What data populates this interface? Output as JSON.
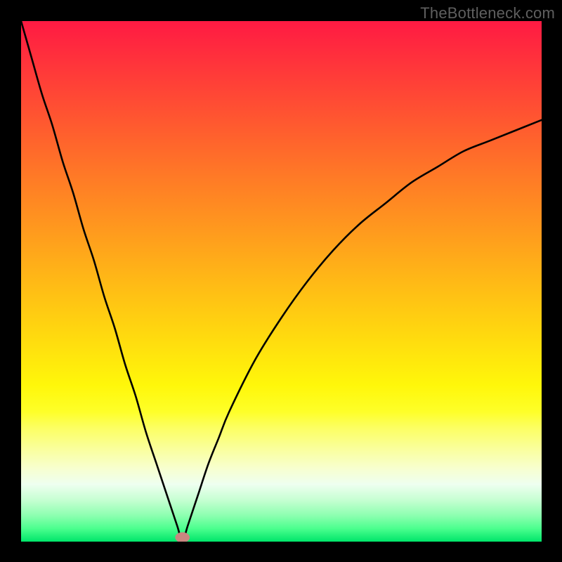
{
  "watermark": {
    "text": "TheBottleneck.com"
  },
  "colors": {
    "frame_border": "#000000",
    "curve": "#000000",
    "marker_fill": "#c98680",
    "gradient_stops": [
      {
        "offset": 0.0,
        "color": "#ff1a43"
      },
      {
        "offset": 0.1,
        "color": "#ff3a39"
      },
      {
        "offset": 0.2,
        "color": "#ff5a2f"
      },
      {
        "offset": 0.3,
        "color": "#ff7a26"
      },
      {
        "offset": 0.4,
        "color": "#ff991e"
      },
      {
        "offset": 0.5,
        "color": "#ffb916"
      },
      {
        "offset": 0.6,
        "color": "#ffd80f"
      },
      {
        "offset": 0.7,
        "color": "#fff70a"
      },
      {
        "offset": 0.75,
        "color": "#feff28"
      },
      {
        "offset": 0.78,
        "color": "#fcff60"
      },
      {
        "offset": 0.82,
        "color": "#faff9a"
      },
      {
        "offset": 0.86,
        "color": "#f7ffd0"
      },
      {
        "offset": 0.89,
        "color": "#eefff0"
      },
      {
        "offset": 0.92,
        "color": "#c6ffd2"
      },
      {
        "offset": 0.95,
        "color": "#8cffb0"
      },
      {
        "offset": 0.975,
        "color": "#4bff8e"
      },
      {
        "offset": 1.0,
        "color": "#00e56a"
      }
    ]
  },
  "chart_data": {
    "type": "line",
    "title": "",
    "xlabel": "",
    "ylabel": "",
    "xlim": [
      0,
      100
    ],
    "ylim": [
      0,
      100
    ],
    "grid": false,
    "note": "V-shaped bottleneck curve. Minimum (0) at x≈31; left branch rises to 100 at x=0; right branch rises toward ~80 at x=100. Values estimated from pixel positions.",
    "x": [
      0,
      2,
      4,
      6,
      8,
      10,
      12,
      14,
      16,
      18,
      20,
      22,
      24,
      26,
      28,
      30,
      31,
      32,
      34,
      36,
      38,
      40,
      45,
      50,
      55,
      60,
      65,
      70,
      75,
      80,
      85,
      90,
      95,
      100
    ],
    "y": [
      100,
      93,
      86,
      80,
      73,
      67,
      60,
      54,
      47,
      41,
      34,
      28,
      21,
      15,
      9,
      3,
      0,
      3,
      9,
      15,
      20,
      25,
      35,
      43,
      50,
      56,
      61,
      65,
      69,
      72,
      75,
      77,
      79,
      81
    ],
    "marker": {
      "x": 31,
      "y": 0.8,
      "rx": 1.4,
      "ry": 1.0,
      "fill": "#c98680"
    }
  }
}
